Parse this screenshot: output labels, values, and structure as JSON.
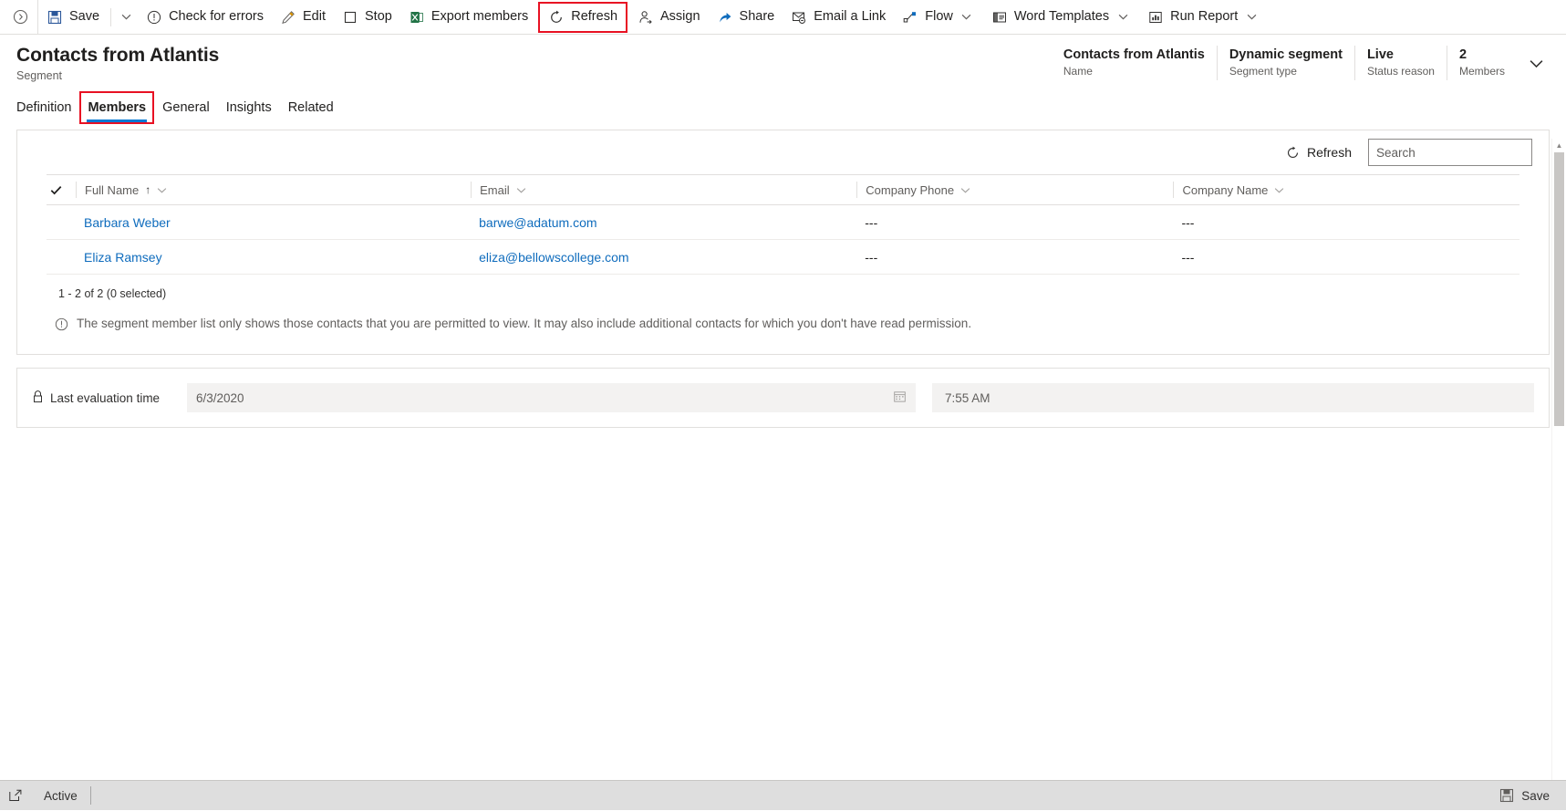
{
  "commandbar": {
    "items": [
      {
        "name": "save",
        "label": "Save",
        "icon": "save-icon",
        "has_split": true
      },
      {
        "name": "check-for-errors",
        "label": "Check for errors",
        "icon": "error-circle-icon"
      },
      {
        "name": "edit",
        "label": "Edit",
        "icon": "pencil-icon"
      },
      {
        "name": "stop",
        "label": "Stop",
        "icon": "stop-square-icon"
      },
      {
        "name": "export-members",
        "label": "Export members",
        "icon": "excel-icon"
      },
      {
        "name": "refresh",
        "label": "Refresh",
        "icon": "refresh-icon",
        "highlighted": true
      },
      {
        "name": "assign",
        "label": "Assign",
        "icon": "assign-person-icon"
      },
      {
        "name": "share",
        "label": "Share",
        "icon": "share-icon"
      },
      {
        "name": "email-a-link",
        "label": "Email a Link",
        "icon": "email-link-icon"
      },
      {
        "name": "flow",
        "label": "Flow",
        "icon": "flow-icon",
        "has_caret": true
      },
      {
        "name": "word-templates",
        "label": "Word Templates",
        "icon": "word-template-icon",
        "has_caret": true
      },
      {
        "name": "run-report",
        "label": "Run Report",
        "icon": "run-report-icon",
        "has_caret": true
      }
    ],
    "highlight_color": "#e81123"
  },
  "header": {
    "title": "Contacts from Atlantis",
    "subtitle": "Segment",
    "fields": [
      {
        "value": "Contacts from Atlantis",
        "label": "Name"
      },
      {
        "value": "Dynamic segment",
        "label": "Segment type"
      },
      {
        "value": "Live",
        "label": "Status reason"
      },
      {
        "value": "2",
        "label": "Members"
      }
    ]
  },
  "tabs": [
    {
      "label": "Definition",
      "active": false,
      "highlighted": false
    },
    {
      "label": "Members",
      "active": true,
      "highlighted": true
    },
    {
      "label": "General",
      "active": false,
      "highlighted": false
    },
    {
      "label": "Insights",
      "active": false,
      "highlighted": false
    },
    {
      "label": "Related",
      "active": false,
      "highlighted": false
    }
  ],
  "grid": {
    "refresh_label": "Refresh",
    "search_placeholder": "Search",
    "search_value": "",
    "columns": [
      {
        "label": "Full Name",
        "sorted": true,
        "sort_arrow": "↑"
      },
      {
        "label": "Email",
        "sorted": false
      },
      {
        "label": "Company Phone",
        "sorted": false
      },
      {
        "label": "Company Name",
        "sorted": false
      }
    ],
    "rows": [
      {
        "full_name": "Barbara Weber",
        "email": "barwe@adatum.com",
        "company_phone": "---",
        "company_name": "---"
      },
      {
        "full_name": "Eliza Ramsey",
        "email": "eliza@bellowscollege.com",
        "company_phone": "---",
        "company_name": "---"
      }
    ],
    "record_count": "1 - 2 of 2 (0 selected)",
    "notice": "The segment member list only shows those contacts that you are permitted to view. It may also include additional contacts for which you don't have read permission."
  },
  "evaluation": {
    "label": "Last evaluation time",
    "date": "6/3/2020",
    "time": "7:55 AM"
  },
  "statusbar": {
    "status": "Active",
    "save_label": "Save"
  },
  "colors": {
    "accent": "#0078d4",
    "link": "#0f6cbd",
    "highlight": "#e81123"
  }
}
